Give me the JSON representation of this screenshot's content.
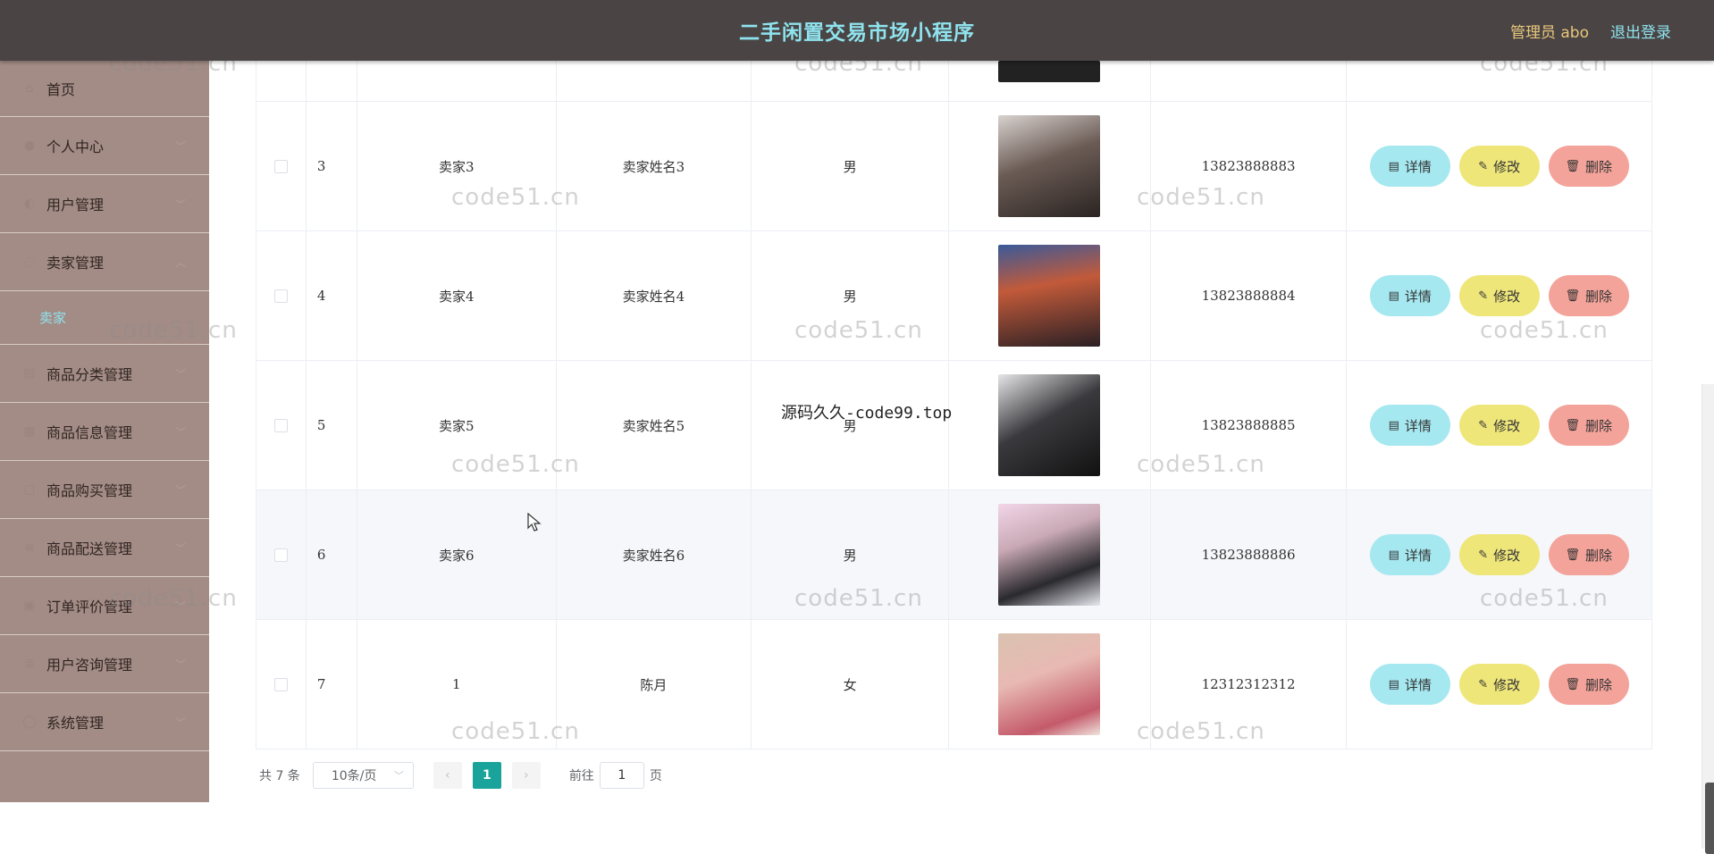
{
  "header": {
    "title": "二手闲置交易市场小程序",
    "admin": "管理员 abo",
    "logout": "退出登录"
  },
  "sidebar": {
    "items": [
      {
        "label": "首页",
        "icon": "home-icon"
      },
      {
        "label": "个人中心",
        "icon": "user-icon"
      },
      {
        "label": "用户管理",
        "icon": "users-icon"
      },
      {
        "label": "卖家管理",
        "icon": "seller-icon"
      },
      {
        "label": "卖家",
        "icon": ""
      },
      {
        "label": "商品分类管理",
        "icon": "category-icon"
      },
      {
        "label": "商品信息管理",
        "icon": "goods-icon"
      },
      {
        "label": "商品购买管理",
        "icon": "cart-icon"
      },
      {
        "label": "商品配送管理",
        "icon": "delivery-icon"
      },
      {
        "label": "订单评价管理",
        "icon": "comment-icon"
      },
      {
        "label": "用户咨询管理",
        "icon": "consult-icon"
      },
      {
        "label": "系统管理",
        "icon": "settings-icon"
      }
    ]
  },
  "table": {
    "rows": [
      {
        "idx": "3",
        "account": "卖家3",
        "name": "卖家姓名3",
        "sex": "男",
        "phone": "13823888883",
        "avatar_color": "#6b5b55"
      },
      {
        "idx": "4",
        "account": "卖家4",
        "name": "卖家姓名4",
        "sex": "男",
        "phone": "13823888884",
        "avatar_color": "#3a4a6a"
      },
      {
        "idx": "5",
        "account": "卖家5",
        "name": "卖家姓名5",
        "sex": "男",
        "phone": "13823888885",
        "avatar_color": "#2f2f33"
      },
      {
        "idx": "6",
        "account": "卖家6",
        "name": "卖家姓名6",
        "sex": "男",
        "phone": "13823888886",
        "avatar_color": "#c9a9b5"
      },
      {
        "idx": "7",
        "account": "1",
        "name": "陈月",
        "sex": "女",
        "phone": "12312312312",
        "avatar_color": "#e8b9b2"
      }
    ],
    "actions": {
      "detail": "详情",
      "edit": "修改",
      "delete": "删除"
    }
  },
  "pagination": {
    "total": "共 7 条",
    "page_size": "10条/页",
    "current_page": "1",
    "goto_label": "前往",
    "goto_value": "1",
    "page_unit": "页"
  },
  "watermarks": {
    "site": "code51.cn",
    "overlay": "源码久久-code99.top"
  }
}
